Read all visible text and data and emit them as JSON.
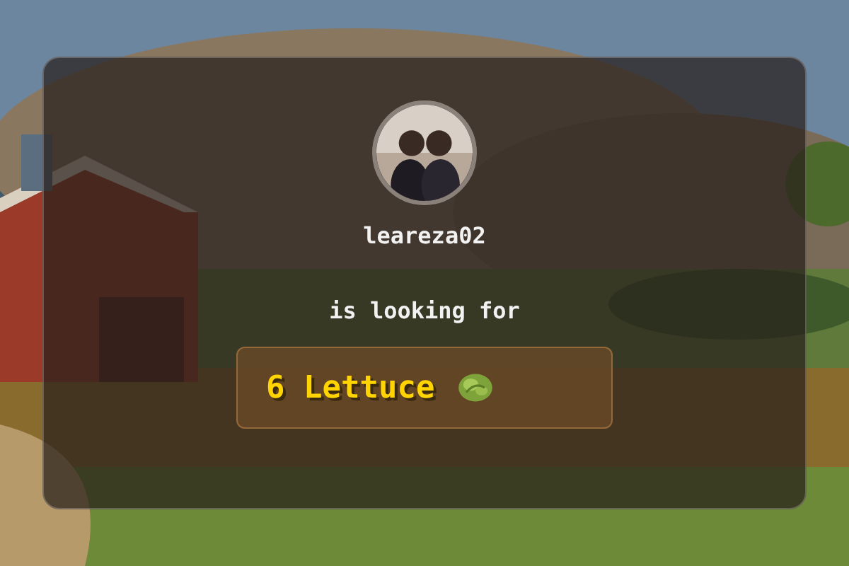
{
  "user": {
    "name": "leareza02"
  },
  "message": "is looking for",
  "request": {
    "text": "6 Lettuce"
  }
}
